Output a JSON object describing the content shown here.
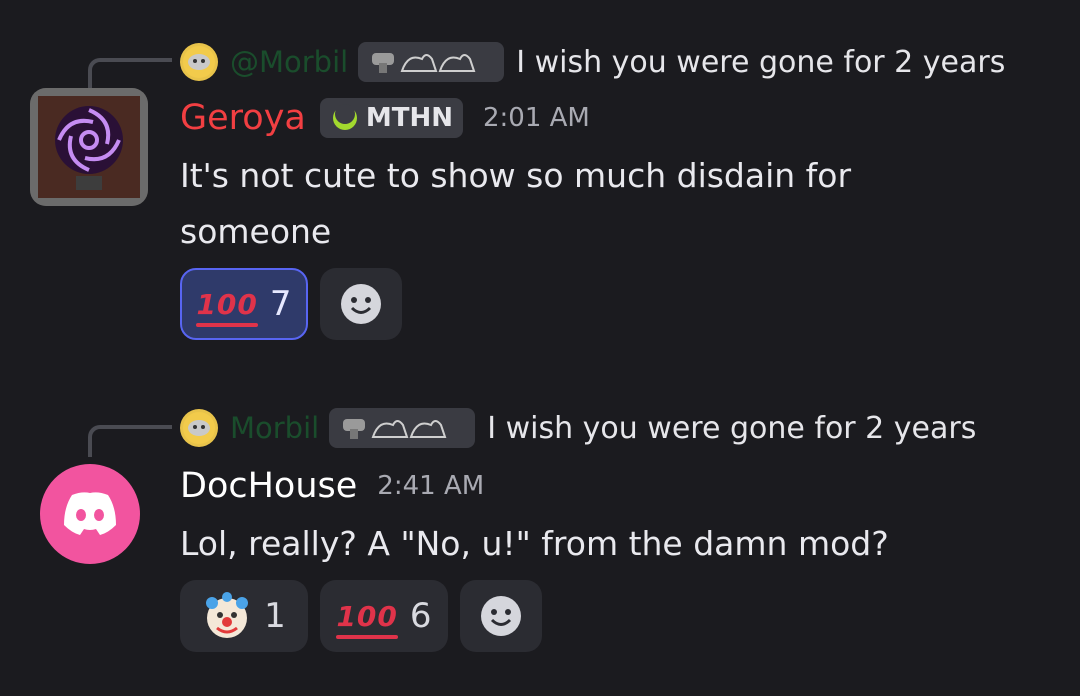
{
  "messages": [
    {
      "reply": {
        "name": "@Morbil",
        "text": "I wish you were gone for 2 years"
      },
      "author": "Geroya",
      "author_color": "#f23f42",
      "role_tag": "MTHN",
      "time": "2:01 AM",
      "text": "It's not cute to show so much disdain for someone",
      "reactions": [
        {
          "emoji": "hundred-points",
          "count": "7",
          "active": true
        }
      ]
    },
    {
      "reply": {
        "name": "Morbil",
        "text": "I wish you were gone for 2 years"
      },
      "author": "DocHouse",
      "author_color": "#ffffff",
      "time": "2:41 AM",
      "text": "Lol, really? A \"No, u!\" from the damn mod?",
      "reactions": [
        {
          "emoji": "clown-face",
          "count": "1",
          "active": false
        },
        {
          "emoji": "hundred-points",
          "count": "6",
          "active": false
        }
      ]
    }
  ],
  "colors": {
    "background": "#1b1b1f",
    "discord_pink": "#f2549f",
    "reaction_active": "#5865f2"
  }
}
